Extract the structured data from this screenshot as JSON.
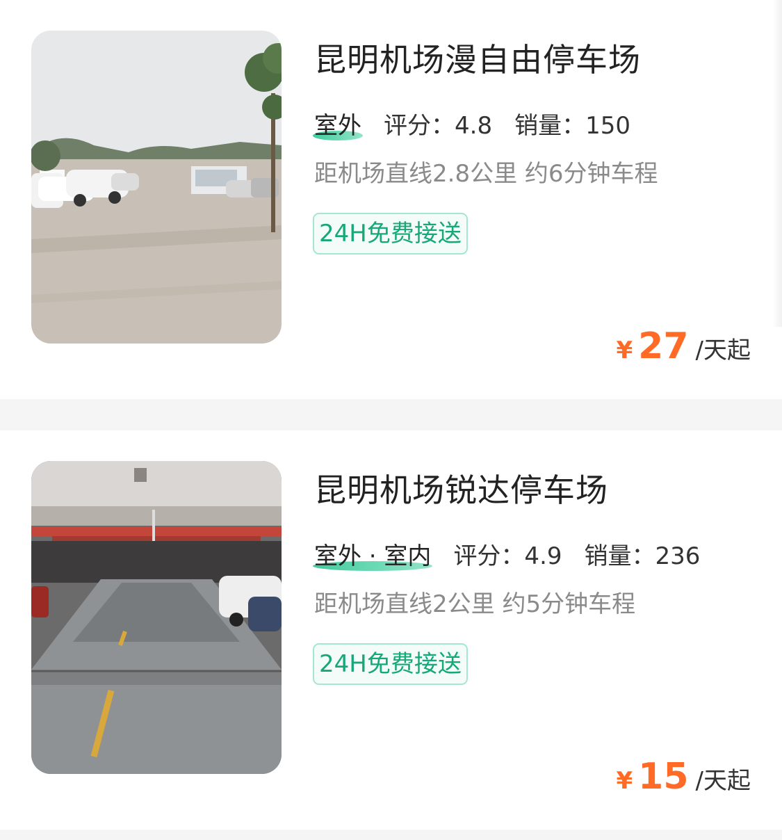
{
  "listings": [
    {
      "title": "昆明机场漫自由停车场",
      "environment": "室外",
      "rating_label": "评分：4.8",
      "sales_label": "销量：150",
      "distance": "距机场直线2.8公里 约6分钟车程",
      "tag": "24H免费接送",
      "price_symbol": "¥",
      "price": "27",
      "price_unit": "/天起"
    },
    {
      "title": "昆明机场锐达停车场",
      "environment": "室外 · 室内",
      "rating_label": "评分：4.9",
      "sales_label": "销量：236",
      "distance": "距机场直线2公里 约5分钟车程",
      "tag": "24H免费接送",
      "price_symbol": "¥",
      "price": "15",
      "price_unit": "/天起"
    }
  ],
  "colors": {
    "accent_price": "#ff6a26",
    "tag_green": "#16a878",
    "env_underline": "#1fc38e"
  }
}
